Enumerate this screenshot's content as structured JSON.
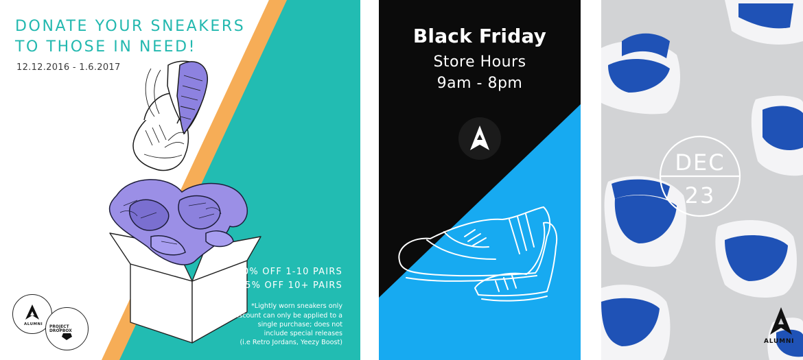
{
  "panel1": {
    "title_line1": "DONATE YOUR SNEAKERS",
    "title_line2": "TO THOSE IN NEED!",
    "dates": "12.12.2016 - 1.6.2017",
    "offer_line1": "10% OFF 1-10 PAIRS",
    "offer_line2": "15% OFF 10+ PAIRS",
    "notes": [
      "*Lightly worn sneakers only",
      "*Discount can only be applied to a",
      "single purchase; does not",
      "include special releases",
      "(i.e Retro Jordans, Yeezy Boost)"
    ],
    "badge_logo_text": "ALUMNI",
    "badge_partner_text": "PROJECT DROPBOX",
    "colors": {
      "teal": "#22bcb2",
      "orange": "#f6ad57",
      "purple": "#9b8fe6"
    }
  },
  "panel2": {
    "title": "Black Friday",
    "subtitle_line1": "Store Hours",
    "subtitle_line2": "9am - 8pm",
    "colors": {
      "black": "#0b0b0b",
      "blue": "#17aaf1"
    }
  },
  "panel3": {
    "month": "DEC",
    "day": "23",
    "brand": "ALUMNI",
    "colors": {
      "background": "#d2d3d5",
      "shoe_blue": "#1f52b6"
    }
  }
}
